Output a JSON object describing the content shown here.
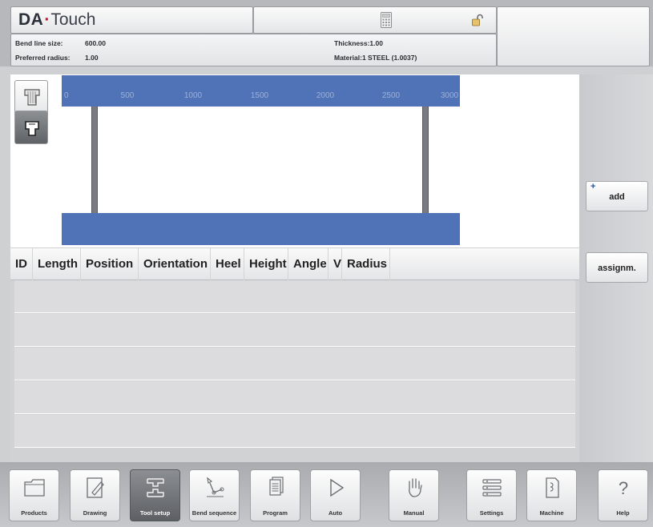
{
  "header": {
    "logo_brand": "DA",
    "logo_dot": "·",
    "logo_product": "Touch",
    "bend_line_label": "Bend line size:",
    "bend_line_value": "600.00",
    "preferred_radius_label": "Preferred radius:",
    "preferred_radius_value": "1.00",
    "thickness": "Thickness:1.00",
    "material": "Material:1 STEEL (1.0037)",
    "icons": [
      "calculator-icon",
      "unlock-icon"
    ]
  },
  "graphic": {
    "scale_ticks": [
      "0",
      "500",
      "1000",
      "1500",
      "2000",
      "2500",
      "3000"
    ],
    "tool_buttons": [
      "upper-tool-icon",
      "lower-tool-icon"
    ],
    "beam_color": "#4f73b6"
  },
  "side_panel": {
    "add_plus": "+",
    "add_label": "add",
    "assign_label": "assignm."
  },
  "table": {
    "columns": [
      "ID",
      "Length",
      "Position",
      "Orientation",
      "Heel",
      "Height",
      "Angle",
      "V",
      "Radius"
    ],
    "rows": []
  },
  "nav": {
    "items": [
      {
        "label": "Products",
        "icon": "folder-icon"
      },
      {
        "label": "Drawing",
        "icon": "drawing-icon"
      },
      {
        "label": "Tool setup",
        "icon": "tool-setup-icon",
        "active": true
      },
      {
        "label": "Bend sequence",
        "icon": "bend-sequence-icon"
      },
      {
        "label": "Program",
        "icon": "program-icon"
      },
      {
        "label": "Auto",
        "icon": "play-icon"
      },
      {
        "label": "Manual",
        "icon": "hand-icon"
      },
      {
        "label": "Settings",
        "icon": "settings-icon"
      },
      {
        "label": "Machine",
        "icon": "machine-icon"
      },
      {
        "label": "Help",
        "icon": "help-icon"
      }
    ]
  }
}
